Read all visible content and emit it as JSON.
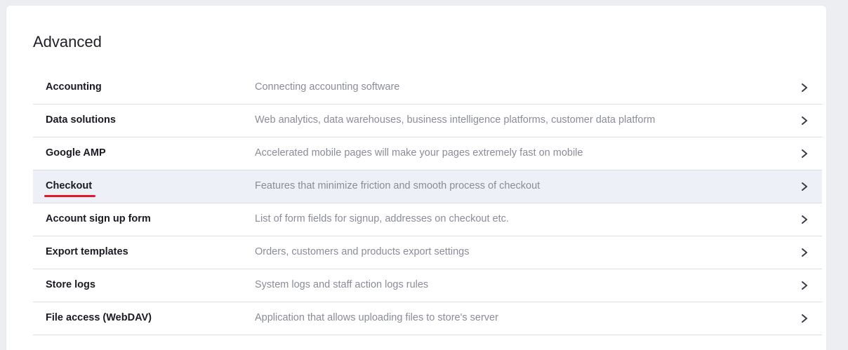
{
  "section": {
    "title": "Advanced"
  },
  "items": [
    {
      "name": "Accounting",
      "description": "Connecting accounting software"
    },
    {
      "name": "Data solutions",
      "description": "Web analytics, data warehouses, business intelligence platforms, customer data platform"
    },
    {
      "name": "Google AMP",
      "description": "Accelerated mobile pages will make your pages extremely fast on mobile"
    },
    {
      "name": "Checkout",
      "description": "Features that minimize friction and smooth process of checkout"
    },
    {
      "name": "Account sign up form",
      "description": "List of form fields for signup, addresses on checkout etc."
    },
    {
      "name": "Export templates",
      "description": "Orders, customers and products export settings"
    },
    {
      "name": "Store logs",
      "description": "System logs and staff action logs rules"
    },
    {
      "name": "File access (WebDAV)",
      "description": "Application that allows uploading files to store's server"
    }
  ],
  "highlight": {
    "row": "Checkout",
    "annotation_color": "#e0192a"
  },
  "icons": {
    "row_arrow": "chevron-right-icon"
  }
}
